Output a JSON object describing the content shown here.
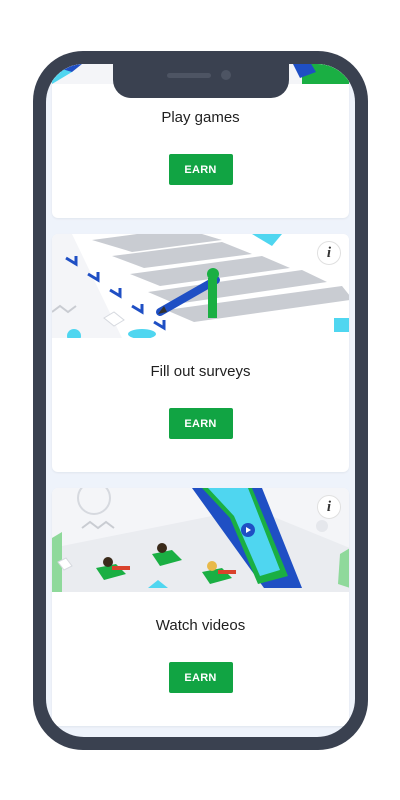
{
  "cards": [
    {
      "title": "Play games",
      "button": "EARN",
      "illustration": "games-illustration"
    },
    {
      "title": "Fill out surveys",
      "button": "EARN",
      "illustration": "survey-illustration",
      "info_icon": "info-icon"
    },
    {
      "title": "Watch videos",
      "button": "EARN",
      "illustration": "video-illustration",
      "info_icon": "info-icon"
    }
  ],
  "colors": {
    "phone_frame": "#3a4150",
    "screen_bg": "#eef3fb",
    "earn_button": "#11a443",
    "accent_blue": "#1f4fc4",
    "accent_green": "#1aaf43",
    "accent_cyan": "#4fd6f0"
  }
}
